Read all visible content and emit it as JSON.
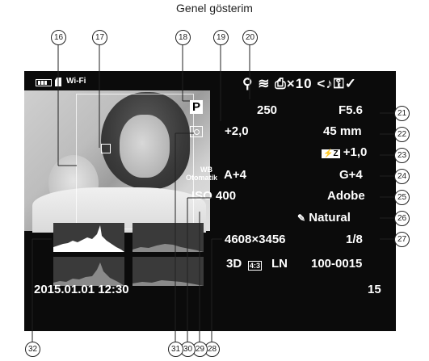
{
  "title": "Genel gösterim",
  "topbar": {
    "wifi_label": "Wi-Fi",
    "icons": [
      "gps-icon",
      "wifi-icon",
      "print-icon",
      "share-icon",
      "sound-icon",
      "protect-icon",
      "check-icon"
    ],
    "print_count": "×10"
  },
  "shooting": {
    "mode": "P",
    "shutter": "250",
    "aperture": "F5.6",
    "exposure_comp": "+2,0",
    "focal_length": "45 mm",
    "flash_comp": "+1,0",
    "wb_line1": "WB",
    "wb_line2": "Otomatik",
    "wb_value": "A+4",
    "wb_green": "G+4",
    "iso": "ISO 400",
    "color_space": "Adobe",
    "picture_mode": "Natural",
    "resolution": "4608×3456",
    "compression": "1/8",
    "three_d": "3D",
    "aspect": "4:3",
    "quality": "LN",
    "file_number": "100-0015",
    "datetime": "2015.01.01 12:30",
    "frame_number": "15"
  },
  "callouts": [
    "16",
    "17",
    "18",
    "19",
    "20",
    "21",
    "22",
    "23",
    "24",
    "25",
    "26",
    "27",
    "28",
    "29",
    "30",
    "31",
    "32"
  ]
}
